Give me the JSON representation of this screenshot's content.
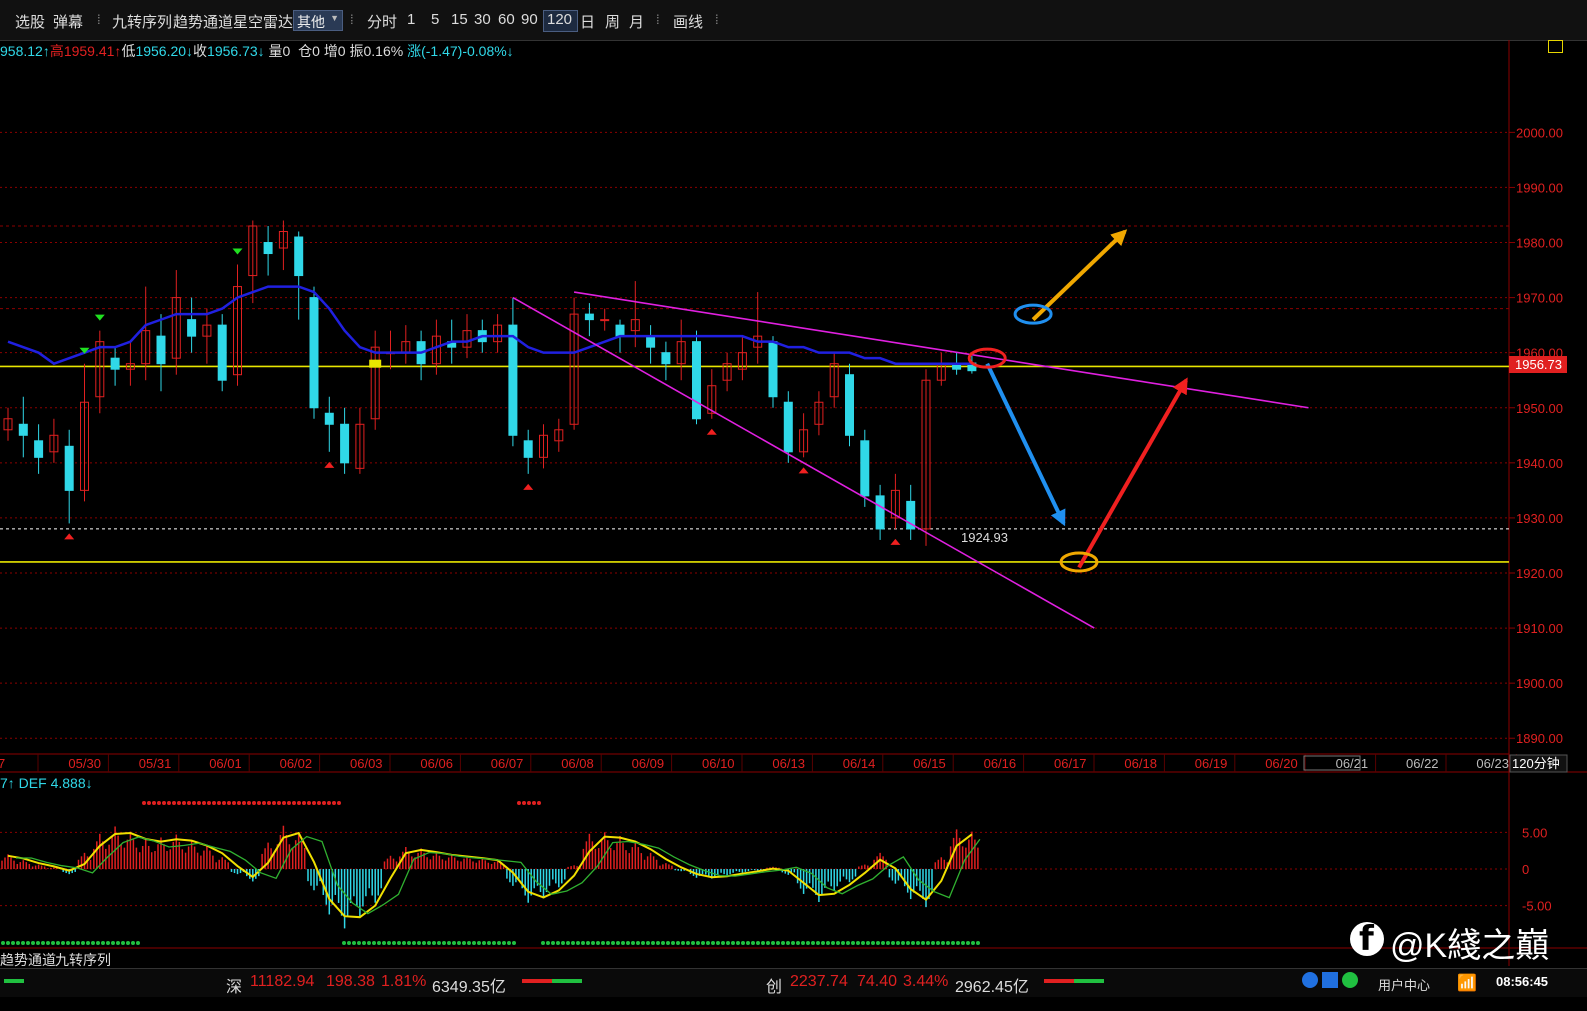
{
  "toolbar": {
    "items": [
      "选股",
      "弹幕",
      "九转序列",
      "趋势通道",
      "星空雷达"
    ],
    "select_value": "其他",
    "periods": [
      "分时",
      "1",
      "5",
      "15",
      "30",
      "60",
      "90",
      "120",
      "日",
      "周",
      "月"
    ],
    "active_period": "120",
    "draw": "画线"
  },
  "info": {
    "open": "958.12↑",
    "high_label": "高",
    "high": "1959.41↑",
    "low_label": "低",
    "low": "1956.20↓",
    "close_label": "收",
    "close": "1956.73↓",
    "vol": "量0",
    "oi": "仓0",
    "inc": "增0",
    "amp": "振0.16%",
    "chg": "涨(-1.47)-0.08%↓"
  },
  "indicator_label": "7↑ DEF 4.888↓",
  "period_label": "120分钟",
  "bottom_tabs": [
    "趋势通道",
    "九转序列"
  ],
  "chart_data": [
    {
      "type": "candlestick",
      "y_axis_ticks": [
        2000,
        1990,
        1980,
        1970,
        1960,
        1950,
        1940,
        1930,
        1920,
        1910,
        1900,
        1890
      ],
      "y_axis_tick_labels": [
        "2000.00",
        "1990.00",
        "1980.00",
        "1970.00",
        "1960.00",
        "1950.00",
        "1940.00",
        "1930.00",
        "1920.00",
        "1910.00",
        "1900.00",
        "1890.00"
      ],
      "ylim": [
        1887.5,
        2013.5
      ],
      "x_tick_labels": [
        "7",
        "05/30",
        "05/31",
        "06/01",
        "06/02",
        "06/03",
        "06/06",
        "06/07",
        "06/08",
        "06/09",
        "06/10",
        "06/13",
        "06/14",
        "06/15",
        "06/16",
        "06/17",
        "06/18",
        "06/19",
        "06/20",
        "06/21",
        "06/22",
        "06/23"
      ],
      "current_price_label": "1956.73",
      "low_marker_label": "1924.93",
      "horizontal_levels": [
        {
          "price": 1957.5,
          "color": "#e8e600"
        },
        {
          "price": 1922,
          "color": "#e8e600"
        },
        {
          "price": 1983,
          "color": "#8b0000"
        },
        {
          "price": 1968,
          "color": "#8b0000"
        },
        {
          "price": 1928,
          "color": "#ffffff"
        }
      ],
      "candles": [
        {
          "x": 0,
          "o": 1946,
          "c": 1948,
          "h": 1950,
          "l": 1944
        },
        {
          "x": 1,
          "o": 1947,
          "c": 1945,
          "h": 1952,
          "l": 1941
        },
        {
          "x": 2,
          "o": 1944,
          "c": 1941,
          "h": 1947,
          "l": 1938
        },
        {
          "x": 3,
          "o": 1942,
          "c": 1945,
          "h": 1948,
          "l": 1940
        },
        {
          "x": 4,
          "o": 1943,
          "c": 1935,
          "h": 1946,
          "l": 1929
        },
        {
          "x": 5,
          "o": 1935,
          "c": 1951,
          "h": 1958,
          "l": 1933
        },
        {
          "x": 6,
          "o": 1952,
          "c": 1962,
          "h": 1964,
          "l": 1949
        },
        {
          "x": 7,
          "o": 1959,
          "c": 1957,
          "h": 1961,
          "l": 1954
        },
        {
          "x": 8,
          "o": 1957,
          "c": 1958,
          "h": 1962,
          "l": 1954
        },
        {
          "x": 9,
          "o": 1958,
          "c": 1964,
          "h": 1972,
          "l": 1955
        },
        {
          "x": 10,
          "o": 1963,
          "c": 1958,
          "h": 1967,
          "l": 1953
        },
        {
          "x": 11,
          "o": 1959,
          "c": 1970,
          "h": 1975,
          "l": 1956
        },
        {
          "x": 12,
          "o": 1966,
          "c": 1963,
          "h": 1970,
          "l": 1960
        },
        {
          "x": 13,
          "o": 1963,
          "c": 1965,
          "h": 1968,
          "l": 1958
        },
        {
          "x": 14,
          "o": 1965,
          "c": 1955,
          "h": 1967,
          "l": 1953
        },
        {
          "x": 15,
          "o": 1956,
          "c": 1972,
          "h": 1976,
          "l": 1954
        },
        {
          "x": 16,
          "o": 1974,
          "c": 1983,
          "h": 1984,
          "l": 1969
        },
        {
          "x": 17,
          "o": 1980,
          "c": 1978,
          "h": 1983,
          "l": 1974
        },
        {
          "x": 18,
          "o": 1979,
          "c": 1982,
          "h": 1984,
          "l": 1975
        },
        {
          "x": 19,
          "o": 1981,
          "c": 1974,
          "h": 1982,
          "l": 1966
        },
        {
          "x": 20,
          "o": 1970,
          "c": 1950,
          "h": 1972,
          "l": 1948
        },
        {
          "x": 21,
          "o": 1949,
          "c": 1947,
          "h": 1952,
          "l": 1942
        },
        {
          "x": 22,
          "o": 1947,
          "c": 1940,
          "h": 1950,
          "l": 1938
        },
        {
          "x": 23,
          "o": 1939,
          "c": 1947,
          "h": 1950,
          "l": 1938
        },
        {
          "x": 24,
          "o": 1948,
          "c": 1961,
          "h": 1964,
          "l": 1946
        },
        {
          "x": 25,
          "o": 1960,
          "c": 1960,
          "h": 1964,
          "l": 1957
        },
        {
          "x": 26,
          "o": 1960,
          "c": 1962,
          "h": 1965,
          "l": 1958
        },
        {
          "x": 27,
          "o": 1962,
          "c": 1958,
          "h": 1964,
          "l": 1955
        },
        {
          "x": 28,
          "o": 1958,
          "c": 1963,
          "h": 1966,
          "l": 1956
        },
        {
          "x": 29,
          "o": 1962,
          "c": 1961,
          "h": 1966,
          "l": 1958
        },
        {
          "x": 30,
          "o": 1961,
          "c": 1964,
          "h": 1967,
          "l": 1959
        },
        {
          "x": 31,
          "o": 1964,
          "c": 1962,
          "h": 1966,
          "l": 1960
        },
        {
          "x": 32,
          "o": 1962,
          "c": 1965,
          "h": 1967,
          "l": 1960
        },
        {
          "x": 33,
          "o": 1965,
          "c": 1945,
          "h": 1970,
          "l": 1943
        },
        {
          "x": 34,
          "o": 1944,
          "c": 1941,
          "h": 1946,
          "l": 1938
        },
        {
          "x": 35,
          "o": 1941,
          "c": 1945,
          "h": 1947,
          "l": 1939
        },
        {
          "x": 36,
          "o": 1944,
          "c": 1946,
          "h": 1948,
          "l": 1942
        },
        {
          "x": 37,
          "o": 1947,
          "c": 1967,
          "h": 1970,
          "l": 1946
        },
        {
          "x": 38,
          "o": 1967,
          "c": 1966,
          "h": 1969,
          "l": 1963
        },
        {
          "x": 39,
          "o": 1966,
          "c": 1966,
          "h": 1968,
          "l": 1964
        },
        {
          "x": 40,
          "o": 1965,
          "c": 1963,
          "h": 1966,
          "l": 1960
        },
        {
          "x": 41,
          "o": 1964,
          "c": 1966,
          "h": 1973,
          "l": 1961
        },
        {
          "x": 42,
          "o": 1963,
          "c": 1961,
          "h": 1965,
          "l": 1958
        },
        {
          "x": 43,
          "o": 1960,
          "c": 1958,
          "h": 1962,
          "l": 1955
        },
        {
          "x": 44,
          "o": 1958,
          "c": 1962,
          "h": 1966,
          "l": 1955
        },
        {
          "x": 45,
          "o": 1962,
          "c": 1948,
          "h": 1964,
          "l": 1947
        },
        {
          "x": 46,
          "o": 1949,
          "c": 1954,
          "h": 1957,
          "l": 1948
        },
        {
          "x": 47,
          "o": 1955,
          "c": 1958,
          "h": 1960,
          "l": 1953
        },
        {
          "x": 48,
          "o": 1957,
          "c": 1960,
          "h": 1963,
          "l": 1955
        },
        {
          "x": 49,
          "o": 1961,
          "c": 1963,
          "h": 1971,
          "l": 1958
        },
        {
          "x": 50,
          "o": 1962,
          "c": 1952,
          "h": 1963,
          "l": 1950
        },
        {
          "x": 51,
          "o": 1951,
          "c": 1942,
          "h": 1953,
          "l": 1940
        },
        {
          "x": 52,
          "o": 1942,
          "c": 1946,
          "h": 1949,
          "l": 1941
        },
        {
          "x": 53,
          "o": 1947,
          "c": 1951,
          "h": 1953,
          "l": 1945
        },
        {
          "x": 54,
          "o": 1952,
          "c": 1958,
          "h": 1960,
          "l": 1950
        },
        {
          "x": 55,
          "o": 1956,
          "c": 1945,
          "h": 1958,
          "l": 1943
        },
        {
          "x": 56,
          "o": 1944,
          "c": 1934,
          "h": 1946,
          "l": 1932
        },
        {
          "x": 57,
          "o": 1934,
          "c": 1928,
          "h": 1936,
          "l": 1926
        },
        {
          "x": 58,
          "o": 1930,
          "c": 1935,
          "h": 1938,
          "l": 1928
        },
        {
          "x": 59,
          "o": 1933,
          "c": 1928,
          "h": 1936,
          "l": 1926
        },
        {
          "x": 60,
          "o": 1928,
          "c": 1955,
          "h": 1957,
          "l": 1924.93
        },
        {
          "x": 61,
          "o": 1955,
          "c": 1958,
          "h": 1960,
          "l": 1954
        },
        {
          "x": 62,
          "o": 1958,
          "c": 1957,
          "h": 1960,
          "l": 1956
        },
        {
          "x": 63,
          "o": 1958.12,
          "c": 1956.73,
          "h": 1959.41,
          "l": 1956.2
        }
      ],
      "trend_line": [
        1962,
        1961,
        1960,
        1958,
        1959,
        1960,
        1961,
        1961,
        1962,
        1965,
        1966,
        1967,
        1967,
        1967,
        1968,
        1970,
        1971,
        1972,
        1972,
        1972,
        1971,
        1968,
        1964,
        1961,
        1960,
        1960,
        1960,
        1960,
        1961,
        1962,
        1962,
        1963,
        1963,
        1963,
        1961,
        1960,
        1960,
        1960,
        1961,
        1962,
        1963,
        1963,
        1963,
        1963,
        1963,
        1963,
        1963,
        1963,
        1963,
        1962,
        1962,
        1961,
        1961,
        1960,
        1960,
        1960,
        1959,
        1959,
        1958,
        1958,
        1958,
        1958,
        1958,
        1958
      ],
      "drawings": [
        {
          "kind": "line",
          "color": "#e020e0",
          "from": [
            33,
            1970
          ],
          "to": [
            71,
            1910
          ]
        },
        {
          "kind": "line",
          "color": "#e020e0",
          "from": [
            37,
            1971
          ],
          "to": [
            85,
            1950
          ]
        },
        {
          "kind": "arrow",
          "color": "#f0a800",
          "from": [
            67,
            1966
          ],
          "to": [
            73,
            1982
          ]
        },
        {
          "kind": "arrow",
          "color": "#2090f0",
          "from": [
            64,
            1958
          ],
          "to": [
            69,
            1929
          ]
        },
        {
          "kind": "arrow",
          "color": "#f02020",
          "from": [
            70,
            1921
          ],
          "to": [
            77,
            1955
          ]
        }
      ],
      "circles": [
        {
          "color": "#2090f0",
          "center": [
            67,
            1967
          ]
        },
        {
          "color": "#f02020",
          "center": [
            64,
            1959
          ]
        },
        {
          "color": "#f0a800",
          "center": [
            70,
            1922
          ]
        }
      ],
      "up_arrows_at": [
        4,
        21,
        34,
        46,
        52,
        58
      ],
      "down_arrows_at": [
        5,
        6,
        15
      ]
    },
    {
      "type": "bar",
      "name": "DEF",
      "y_axis_tick_labels": [
        "5.00",
        "0",
        "-5.00"
      ],
      "ylim": [
        -10.5,
        10.5
      ],
      "values": [
        2.0,
        1.2,
        0.6,
        0.2,
        -0.7,
        2.2,
        4.8,
        5.8,
        5.1,
        4.0,
        4.3,
        4.7,
        3.9,
        3.2,
        1.6,
        -0.7,
        -1.7,
        3.6,
        5.9,
        5.0,
        -2.9,
        -6.2,
        -8.1,
        -6.5,
        -4.6,
        1.8,
        3.0,
        2.8,
        2.3,
        2.0,
        1.8,
        1.5,
        1.2,
        -2.3,
        -4.6,
        -4.0,
        -2.5,
        0.5,
        4.8,
        5.0,
        4.5,
        3.8,
        2.2,
        0.8,
        -0.3,
        -1.2,
        -1.3,
        -0.9,
        -0.5,
        -0.2,
        0.3,
        -0.8,
        -3.4,
        -4.5,
        -3.0,
        -1.8,
        0.6,
        2.2,
        -2.0,
        -4.1,
        -5.2,
        1.6,
        5.4,
        5.1
      ]
    }
  ],
  "ticker": {
    "shen_label": "深",
    "shen_val": "11182.94",
    "shen_chg": "198.38",
    "shen_pct": "1.81%",
    "shen_amt": "6349.35亿",
    "chuang_label": "创",
    "chuang_val": "2237.74",
    "chuang_chg": "74.40",
    "chuang_pct": "3.44%",
    "chuang_amt": "2962.45亿",
    "user_center": "用户中心",
    "time": "08:56:45"
  },
  "watermark": "@K綫之巔",
  "colors": {
    "up": "#e02020",
    "down": "#30d8e8",
    "ma": "#2020e0",
    "grid": "#8b0000"
  }
}
